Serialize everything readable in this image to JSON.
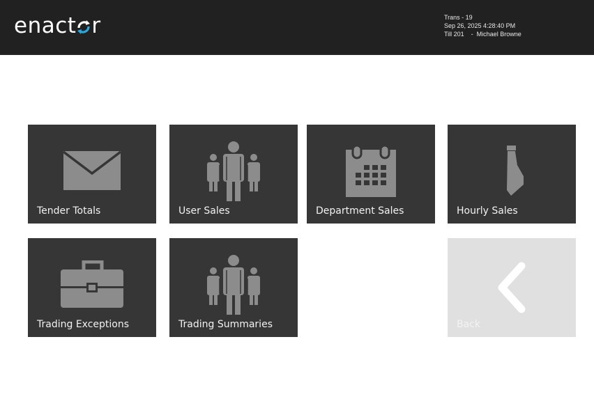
{
  "header": {
    "logo_text_left": "enact",
    "logo_text_right": "r",
    "trans": "Trans - 19",
    "datetime": "Sep 26, 2025 4:28:40 PM",
    "till_user": "Till 201    -  Michael Browne"
  },
  "tiles": [
    {
      "label": "Tender Totals",
      "icon": "envelope-icon"
    },
    {
      "label": "User Sales",
      "icon": "people-icon"
    },
    {
      "label": "Department Sales",
      "icon": "calendar-icon"
    },
    {
      "label": "Hourly Sales",
      "icon": "tie-icon"
    },
    {
      "label": "Trading Exceptions",
      "icon": "briefcase-icon"
    },
    {
      "label": "Trading Summaries",
      "icon": "people-icon"
    },
    {
      "label": "Back",
      "icon": "chevron-left-icon"
    }
  ],
  "colors": {
    "header_bg": "#212121",
    "tile_bg": "#363636",
    "icon_gray": "#8c8c8c",
    "logo_accent": "#29a8e0",
    "back_bg": "#e0e0e0"
  }
}
